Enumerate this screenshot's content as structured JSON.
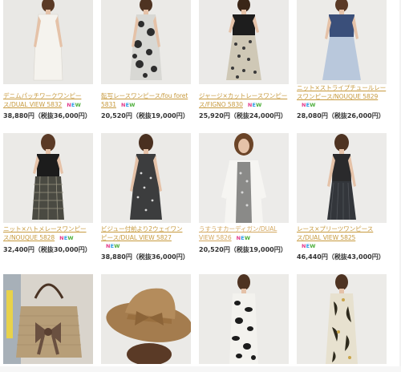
{
  "products": [
    {
      "name1": "デニムパッチワークワンピー",
      "name2": "ス/DUAL VIEW  5832",
      "badge": "NEW",
      "price": "38,880円（税抜36,000円）",
      "image": "white-dress-photo"
    },
    {
      "name1": "転写レースワンピース/fou foret",
      "name2": "5831",
      "badge": "NEW",
      "price": "20,520円（税抜19,000円）",
      "image": "floral-dress-photo"
    },
    {
      "name1": "ジャージ×カットレースワンピー",
      "name2": "ス/FIGNO  5830",
      "badge": "NEW",
      "price": "25,920円（税抜24,000円）",
      "image": "black-lace-dress-photo"
    },
    {
      "name1": "ニット×ストライプチュールレー",
      "name2": "スワンピース/NOUQUE  5829",
      "badge": "NEW",
      "price": "28,080円（税抜26,000円）",
      "image": "blue-tulle-dress-photo"
    },
    {
      "name1": "ニット×ハトメレースワンピー",
      "name2": "ス/NOUQUE  5828",
      "badge": "NEW",
      "price": "32,400円（税抜30,000円）",
      "image": "black-check-dress-photo"
    },
    {
      "name1": "ビジュー付前より2ウェイワン",
      "name2": "ピース/DUAL VIEW  5827",
      "badge": "NEW",
      "price": "38,880円（税抜36,000円）",
      "image": "grey-bijou-dress-photo"
    },
    {
      "name1": "うすうすカーディガン/DUAL",
      "name2": "VIEW  5826",
      "badge": "NEW",
      "price": "20,520円（税抜19,000円）",
      "image": "white-cardigan-photo"
    },
    {
      "name1": "レース×プリーツワンピース",
      "name2": "ス/DUAL VIEW  5825",
      "badge": "NEW",
      "price": "46,440円（税抜43,000円）",
      "image": "black-lace-pleat-photo"
    },
    {
      "image": "straw-bag-photo"
    },
    {
      "image": "straw-hat-photo"
    },
    {
      "image": "black-white-print-dress-photo"
    },
    {
      "image": "botanical-print-dress-photo"
    }
  ]
}
